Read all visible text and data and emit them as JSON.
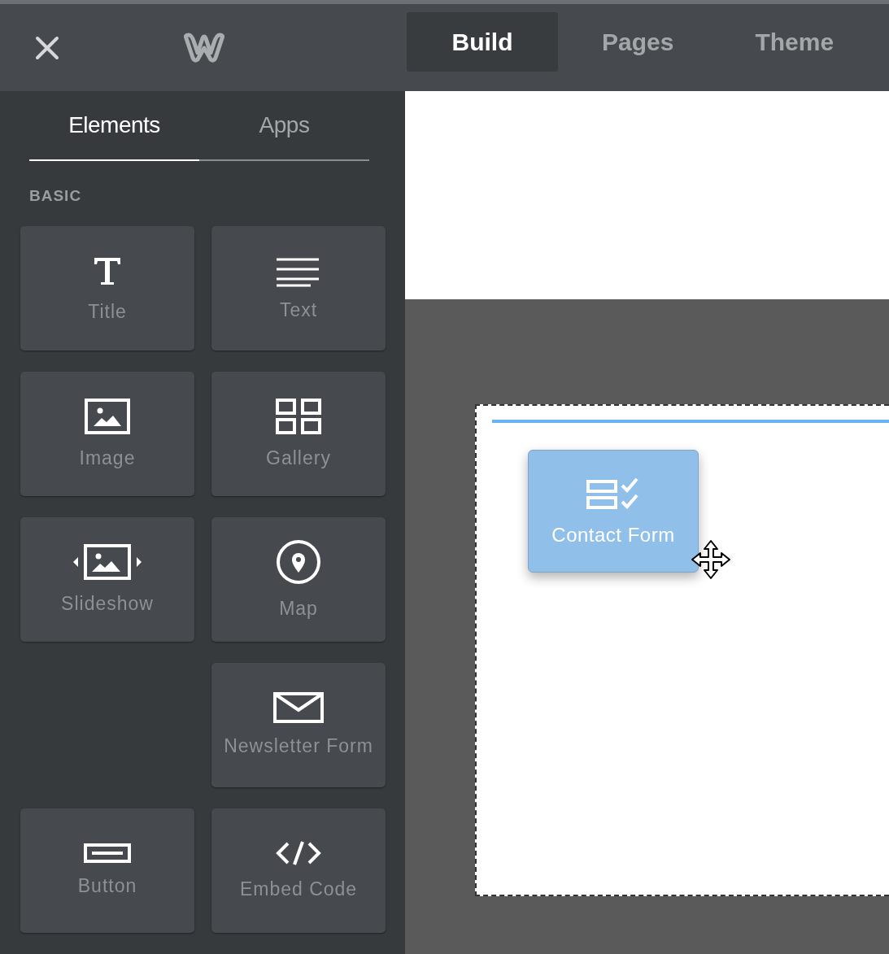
{
  "top_tabs": [
    {
      "label": "Build",
      "selected": true
    },
    {
      "label": "Pages",
      "selected": false
    },
    {
      "label": "Theme",
      "selected": false
    }
  ],
  "sidebar": {
    "tabs": [
      {
        "label": "Elements",
        "selected": true
      },
      {
        "label": "Apps",
        "selected": false
      }
    ],
    "section": "BASIC",
    "items": [
      {
        "kind": "title",
        "label": "Title"
      },
      {
        "kind": "text",
        "label": "Text"
      },
      {
        "kind": "image",
        "label": "Image"
      },
      {
        "kind": "gallery",
        "label": "Gallery"
      },
      {
        "kind": "slideshow",
        "label": "Slideshow"
      },
      {
        "kind": "map",
        "label": "Map"
      },
      {
        "kind": "newsletter",
        "label": "Newsletter Form"
      },
      {
        "kind": "button",
        "label": "Button"
      },
      {
        "kind": "embed",
        "label": "Embed Code"
      }
    ]
  },
  "dragged": {
    "label": "Contact Form"
  }
}
